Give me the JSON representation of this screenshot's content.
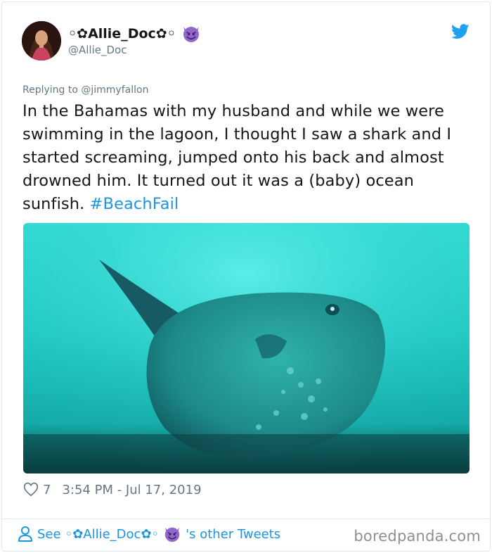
{
  "author": {
    "display_name": "◦✿Allie_Doc✿◦",
    "handle": "@Allie_Doc"
  },
  "tweet": {
    "replying_to": "Replying to @jimmyfallon",
    "text": "In the Bahamas with my husband and while we were swimming in the lagoon, I thought I saw a shark and I started screaming, jumped onto his back and almost drowned him.  It turned out it was a (baby) ocean sunfish. ",
    "hashtag": "#BeachFail",
    "likes": "7",
    "timestamp": "3:54 PM - Jul 17, 2019"
  },
  "footer": {
    "see_prefix": "See",
    "author_name": "◦✿Allie_Doc✿◦",
    "other_tweets": "'s other Tweets"
  },
  "watermark": "boredpanda.com",
  "colors": {
    "link": "#1b95e0",
    "muted": "#657786",
    "devil": "#9266cc"
  },
  "icons": [
    "devil-emoji-icon",
    "twitter-bird-icon",
    "heart-icon",
    "person-icon"
  ]
}
